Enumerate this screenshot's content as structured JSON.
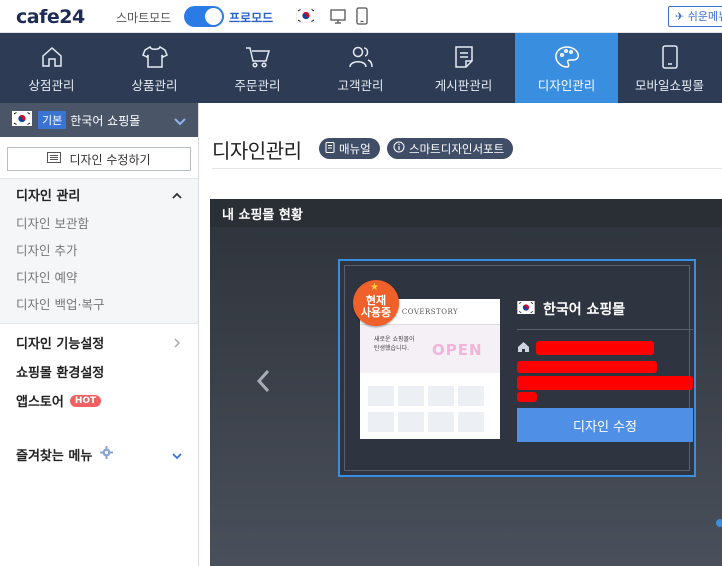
{
  "topbar": {
    "logo": "cafe24",
    "smart_mode": "스마트모드",
    "pro_mode": "프로모드",
    "easy_button": "쉬운메뉴"
  },
  "nav": {
    "items": [
      {
        "label": "상점관리",
        "icon": "home-icon"
      },
      {
        "label": "상품관리",
        "icon": "shirt-icon"
      },
      {
        "label": "주문관리",
        "icon": "cart-icon"
      },
      {
        "label": "고객관리",
        "icon": "users-icon"
      },
      {
        "label": "게시판관리",
        "icon": "board-icon"
      },
      {
        "label": "디자인관리",
        "icon": "palette-icon",
        "active": true
      },
      {
        "label": "모바일쇼핑몰",
        "icon": "mobile-icon"
      }
    ]
  },
  "sidebar": {
    "shop_badge": "기본",
    "shop_name": "한국어 쇼핑몰",
    "edit_button": "디자인 수정하기",
    "section_title": "디자인 관리",
    "sub_items": [
      "디자인 보관함",
      "디자인 추가",
      "디자인 예약",
      "디자인 백업·복구"
    ],
    "menu_items": [
      "디자인 기능설정",
      "쇼핑몰 환경설정",
      "앱스토어"
    ],
    "hot_badge": "HOT",
    "favorites": "즐겨찾는 메뉴"
  },
  "content": {
    "title": "디자인관리",
    "manual_button": "매뉴얼",
    "support_button": "스마트디자인서포트",
    "panel_title": "내 쇼핑몰 현황",
    "current_badge_line1": "현재",
    "current_badge_line2": "사용중",
    "thumbnail": {
      "brand": "COVERSTORY",
      "banner_text_1": "새로운 쇼핑몰이",
      "banner_text_2": "탄생했습니다.",
      "banner_open": "OPEN"
    },
    "card_shop_name": "한국어 쇼핑몰",
    "design_edit_button": "디자인 수정"
  },
  "colors": {
    "nav_bg": "#2d3b55",
    "nav_active": "#3a8ee0",
    "accent": "#2b7be6",
    "hot": "#f06060",
    "badge_orange": "#f0602a"
  }
}
